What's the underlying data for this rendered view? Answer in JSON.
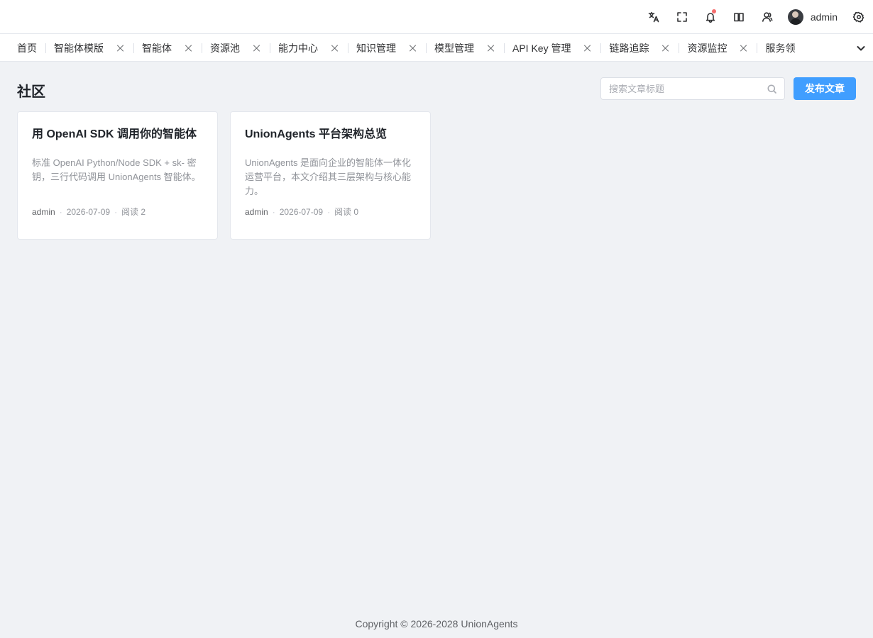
{
  "header": {
    "icons": [
      "translate-icon",
      "fullscreen-icon",
      "bell-icon",
      "book-icon",
      "user-icon",
      "gear-icon"
    ],
    "username": "admin",
    "notification_dot_color": "#f56c6c"
  },
  "tabs": [
    {
      "label": "首页",
      "closable": false
    },
    {
      "label": "智能体模版",
      "closable": true
    },
    {
      "label": "智能体",
      "closable": true
    },
    {
      "label": "资源池",
      "closable": true
    },
    {
      "label": "能力中心",
      "closable": true
    },
    {
      "label": "知识管理",
      "closable": true
    },
    {
      "label": "模型管理",
      "closable": true
    },
    {
      "label": "API Key 管理",
      "closable": true
    },
    {
      "label": "链路追踪",
      "closable": true
    },
    {
      "label": "资源监控",
      "closable": true
    },
    {
      "label": "服务领",
      "closable": false
    }
  ],
  "page": {
    "title": "社区",
    "search_placeholder": "搜索文章标题",
    "publish_label": "发布文章",
    "accent_color": "#409eff"
  },
  "articles": [
    {
      "title": "用 OpenAI SDK 调用你的智能体",
      "summary": "标准 OpenAI Python/Node SDK + sk- 密钥，三行代码调用 UnionAgents 智能体。",
      "author": "admin",
      "date": "2026-07-09",
      "reads": "阅读 2"
    },
    {
      "title": "UnionAgents 平台架构总览",
      "summary": "UnionAgents 是面向企业的智能体一体化运营平台，本文介绍其三层架构与核心能力。",
      "author": "admin",
      "date": "2026-07-09",
      "reads": "阅读 0"
    }
  ],
  "footer": {
    "copyright": "Copyright © 2026-2028 UnionAgents"
  }
}
